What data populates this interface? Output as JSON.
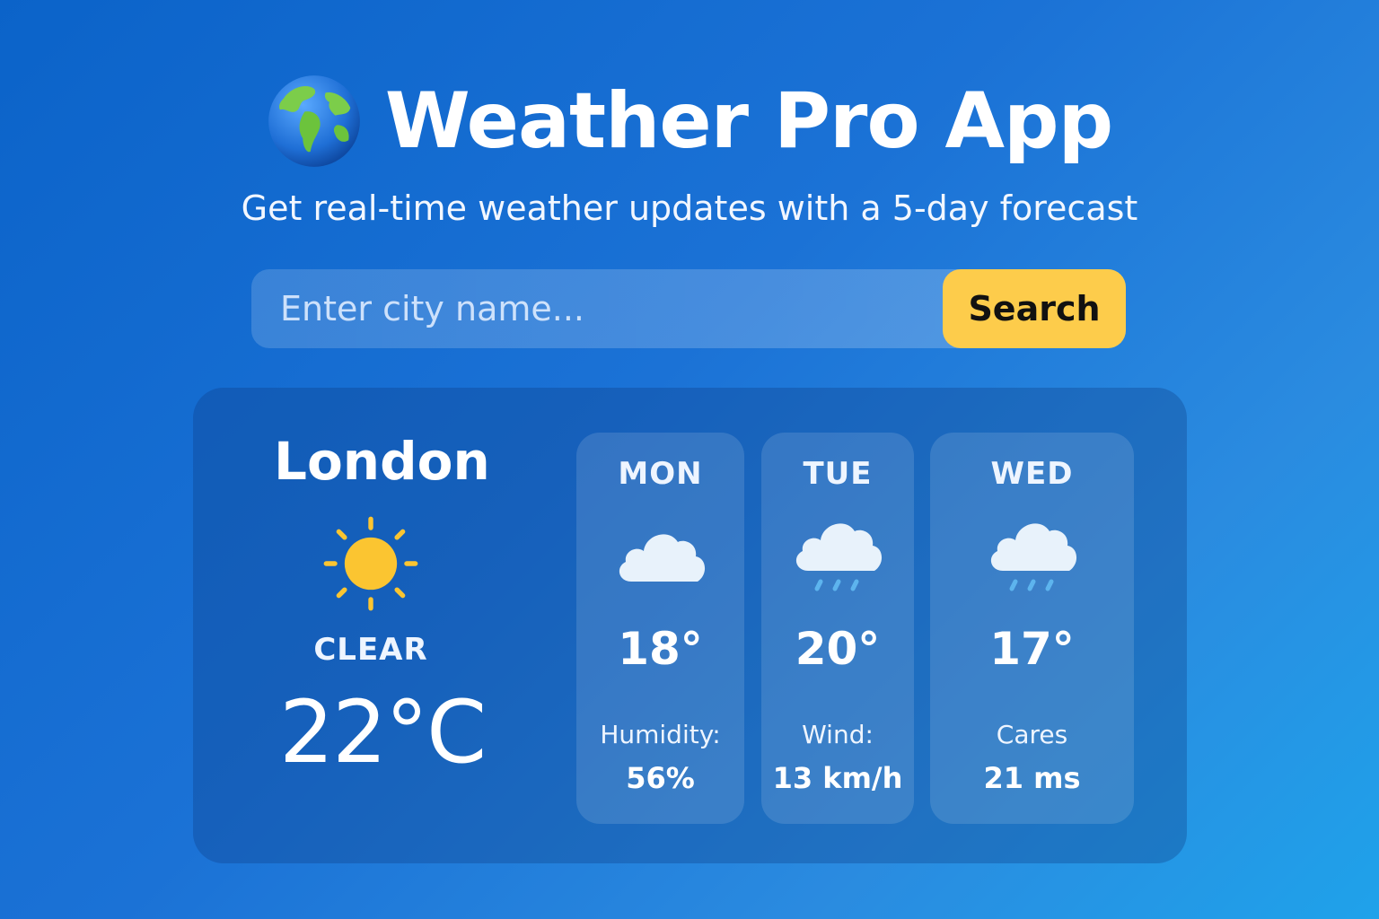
{
  "header": {
    "title": "Weather Pro App",
    "subtitle": "Get real-time weather updates with a 5-day forecast"
  },
  "search": {
    "placeholder": "Enter city name...",
    "value": "",
    "button_label": "Search"
  },
  "current": {
    "city": "London",
    "condition": "CLEAR",
    "temperature": "22°C",
    "icon": "sun-icon"
  },
  "forecast": [
    {
      "day": "MON",
      "icon": "cloud-icon",
      "temp": "18°",
      "stat_label": "Humidity:",
      "stat_value": "56%"
    },
    {
      "day": "TUE",
      "icon": "rain-cloud-icon",
      "temp": "20°",
      "stat_label": "Wind:",
      "stat_value": "13 km/h"
    },
    {
      "day": "WED",
      "icon": "rain-cloud-icon",
      "temp": "17°",
      "stat_label": "Cares",
      "stat_value": "21 ms"
    }
  ],
  "colors": {
    "background_start": "#0b63c9",
    "background_end": "#1fa2ea",
    "search_button": "#fdcc4b",
    "sun": "#fbc531",
    "cloud": "#e8f2fb",
    "rain": "#5db4ee"
  }
}
